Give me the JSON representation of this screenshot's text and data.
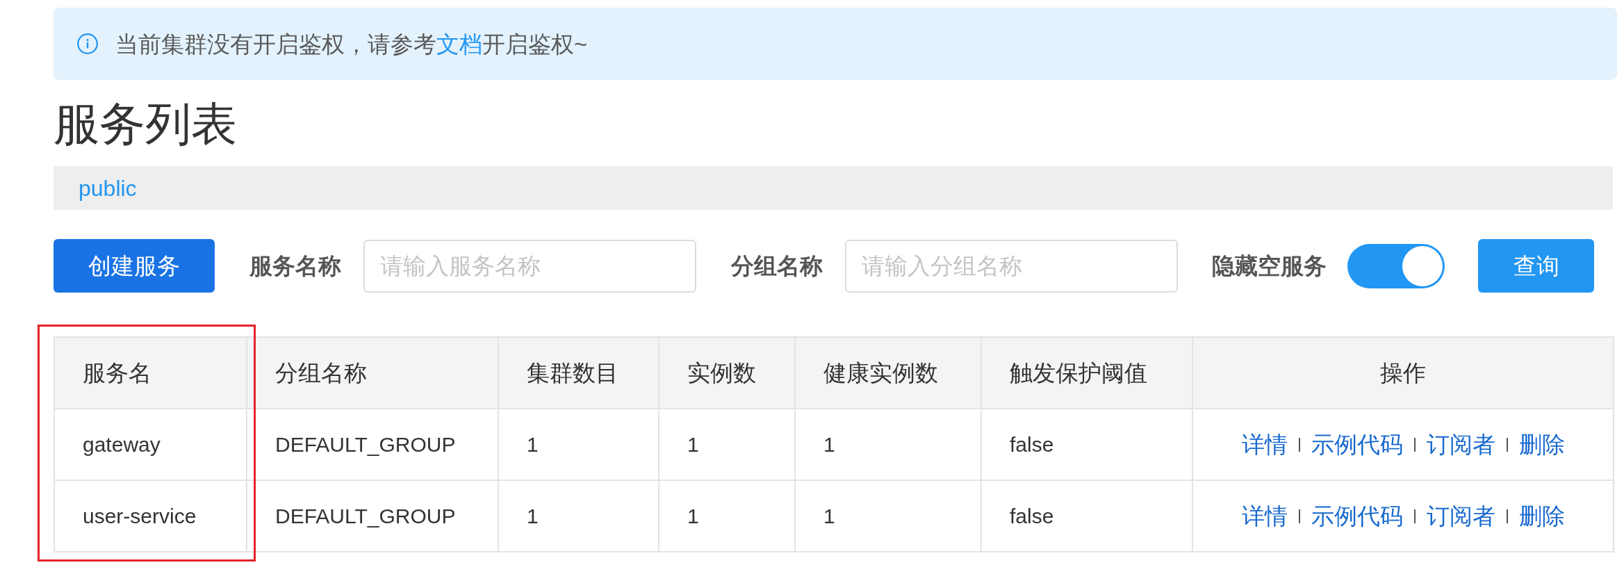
{
  "notice": {
    "text_before": "当前集群没有开启鉴权，请参考",
    "link": "文档",
    "text_after": "开启鉴权~"
  },
  "title": "服务列表",
  "namespaces": [
    {
      "label": "public",
      "selected": true
    }
  ],
  "toolbar": {
    "create_button": "创建服务",
    "fields": [
      {
        "label": "服务名称",
        "placeholder": "请输入服务名称"
      },
      {
        "label": "分组名称",
        "placeholder": "请输入分组名称"
      }
    ],
    "hide_empty": {
      "label": "隐藏空服务",
      "on": true
    },
    "query_button": "查询"
  },
  "table": {
    "columns": [
      {
        "label": "服务名",
        "kind": "text",
        "highlighted": true
      },
      {
        "label": "分组名称",
        "kind": "text",
        "highlighted": false
      },
      {
        "label": "集群数目",
        "kind": "text",
        "highlighted": false
      },
      {
        "label": "实例数",
        "kind": "text",
        "highlighted": false
      },
      {
        "label": "健康实例数",
        "kind": "text",
        "highlighted": false
      },
      {
        "label": "触发保护阈值",
        "kind": "text",
        "highlighted": false
      },
      {
        "label": "操作",
        "kind": "actions",
        "highlighted": false
      }
    ],
    "rows": [
      {
        "cells": [
          "gateway",
          "DEFAULT_GROUP",
          "1",
          "1",
          "1",
          "false"
        ],
        "actions": [
          "详情",
          "示例代码",
          "订阅者",
          "删除"
        ]
      },
      {
        "cells": [
          "user-service",
          "DEFAULT_GROUP",
          "1",
          "1",
          "1",
          "false"
        ],
        "actions": [
          "详情",
          "示例代码",
          "订阅者",
          "删除"
        ]
      }
    ]
  }
}
